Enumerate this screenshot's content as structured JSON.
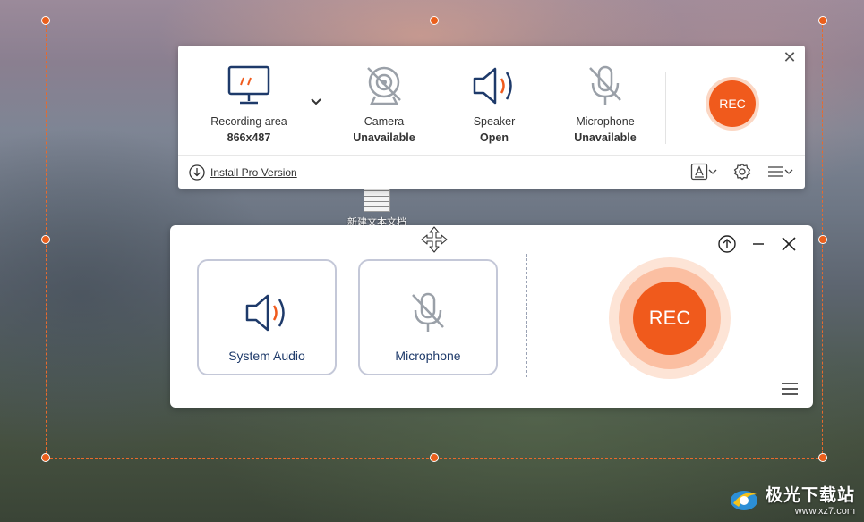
{
  "desktop": {
    "icon_label": "新建文本文档"
  },
  "toolbar": {
    "recording_area": {
      "label": "Recording area",
      "value": "866x487"
    },
    "camera": {
      "label": "Camera",
      "value": "Unavailable"
    },
    "speaker": {
      "label": "Speaker",
      "value": "Open"
    },
    "microphone": {
      "label": "Microphone",
      "value": "Unavailable"
    },
    "rec_label": "REC",
    "install_label": "Install Pro Version"
  },
  "audio_panel": {
    "system_audio_label": "System Audio",
    "microphone_label": "Microphone",
    "rec_label": "REC"
  },
  "watermark": {
    "cn": "极光下载站",
    "url": "www.xz7.com"
  },
  "colors": {
    "accent": "#f05a1c",
    "selection": "#e86a2c",
    "icon_navy": "#1e3a6a"
  }
}
